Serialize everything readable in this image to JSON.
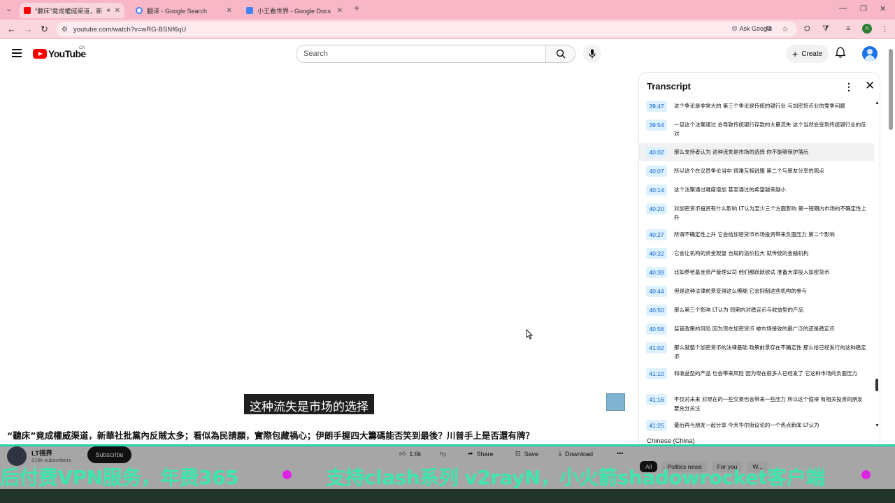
{
  "browser": {
    "tabs": [
      {
        "title": "\"聽床\"竟成權威渠道，新華社...",
        "active": true,
        "fav_color": "#ff0000"
      },
      {
        "title": "翻译 - Google Search",
        "active": false,
        "fav_color": "#4285f4"
      },
      {
        "title": "小王看世界 - Google Docs",
        "active": false,
        "fav_color": "#4285f4"
      }
    ],
    "new_tab": "+",
    "url": "youtube.com/watch?v=wRG-BSNf6qU",
    "ask_google": "Ask Google",
    "profile_initial": "n"
  },
  "youtube": {
    "logo_text": "YouTube",
    "country": "CA",
    "search_placeholder": "Search",
    "create_label": "Create"
  },
  "video": {
    "subtitle": "这种流失是市场的选择",
    "title": "“聽床”竟成權威渠道，新華社批黨內反賊太多；看似為民請願，實際包藏禍心；伊朗手握四大籌碼能否笑到最後？川普手上是否還有牌？",
    "channel": "LT視界",
    "subscribers": "216k subscribers",
    "subscribe_label": "Subscribe",
    "likes": "1.6k",
    "share_label": "Share",
    "save_label": "Save",
    "download_label": "Download",
    "more": "•••"
  },
  "transcript": {
    "title": "Transcript",
    "language": "Chinese (China)",
    "segments": [
      {
        "time": "39:47",
        "text": "这个争论是非常大的 第三个争论是传统的银行业 与加密货币业的竞争问题"
      },
      {
        "time": "39:54",
        "text": "一旦这个法案通过 会导致传统银行存款的大量流失 这个当然会受到传统银行业的反对"
      },
      {
        "time": "40:02",
        "text": "那么支持者认为 这种流失是市场的选择 你不能够保护落后",
        "highlight": true
      },
      {
        "time": "40:07",
        "text": "所以这个在议员争论当中 很难互相说服 第二个与朋友分享的观点"
      },
      {
        "time": "40:14",
        "text": "这个法案通过难度增加 甚至通过的希望越来越小"
      },
      {
        "time": "40:20",
        "text": "对加密货币投资有什么影响 LT认为至少三个方面影响 第一短期内市场的不确定性上升"
      },
      {
        "time": "40:27",
        "text": "所谓不确定性上升 它会给加密货币市场投资带来负面压力 第二个影响"
      },
      {
        "time": "40:32",
        "text": "它会让机构的资金观望 合规的溢价拉大 就传统的金融机构"
      },
      {
        "time": "40:39",
        "text": "比如养老基金资产管理公司 他们都跃跃欲试 准备大举投入加密货币"
      },
      {
        "time": "40:44",
        "text": "但是这种法律前景变得这么模糊 它会抑制这些机构的参与"
      },
      {
        "time": "40:50",
        "text": "那么第三个影响 LT认为 短期内对稳定币与收益型的产品"
      },
      {
        "time": "40:56",
        "text": "监管政策的风险 因为现在加密货币 被市场接收的最广泛的还是稳定币"
      },
      {
        "time": "41:02",
        "text": "那么就整个加密货币的法律基础 政策前景存在不确定性 那么给已经发行的这种稳定币"
      },
      {
        "time": "41:10",
        "text": "和收益型的产品 也会带来风险 因为现在很多人已经发了 它这种市场的负面压力"
      },
      {
        "time": "41:16",
        "text": "不仅对未来 对现在的一些交易也会带来一些压力 所以这个值得 有相关投资的朋友要充分关注"
      },
      {
        "time": "41:25",
        "text": "最后再与朋友一起分享 今天华尔街议论的一个热点新闻 LT认为"
      }
    ]
  },
  "filters": [
    "All",
    "Politics news",
    "For you",
    "W..."
  ],
  "ad_banner": {
    "left_text": "后付费VPN服务，年费365",
    "right_text": "支持clash系列 v2rayN，小火箭shadowrocket客户端",
    "accent": "#3ee6ad",
    "dot_color": "#e024e6"
  },
  "colors": {
    "chrome_tabbar": "#f7b7c7",
    "chrome_toolbar": "#fbd5de",
    "yt_red": "#ff0000",
    "timestamp_bg": "#def1ff",
    "timestamp_text": "#065fd4"
  }
}
